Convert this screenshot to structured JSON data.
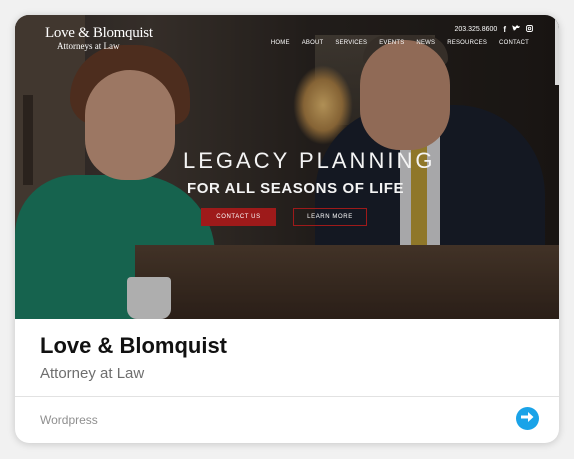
{
  "hero": {
    "logo_name": "Love & Blomquist",
    "logo_sub": "Attorneys at Law",
    "phone": "203.325.8600",
    "social_icons": [
      "facebook-icon",
      "twitter-icon",
      "instagram-icon"
    ],
    "nav": [
      "HOME",
      "ABOUT",
      "SERVICES",
      "EVENTS",
      "NEWS",
      "RESOURCES",
      "CONTACT"
    ],
    "headline": "LEGACY PLANNING",
    "subheadline": "FOR ALL SEASONS OF LIFE",
    "cta_contact": "CONTACT US",
    "cta_learn": "LEARN MORE",
    "accent": "#9e1a1a"
  },
  "card": {
    "title": "Love & Blomquist",
    "subtitle": "Attorney at Law",
    "platform": "Wordpress",
    "go_button_icon": "arrow-right-circle-icon",
    "go_button_color": "#1aa3e8"
  }
}
